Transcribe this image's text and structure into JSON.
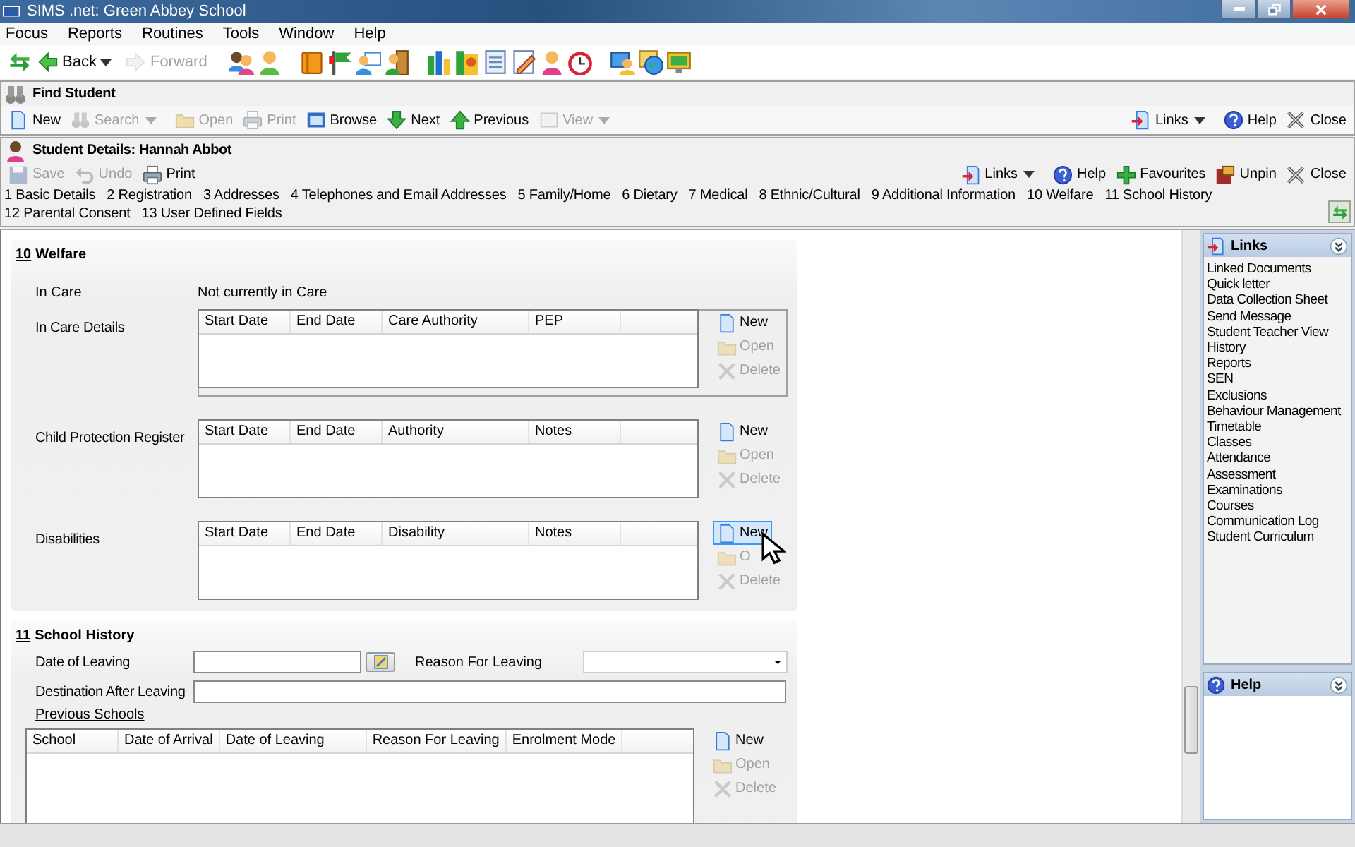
{
  "window": {
    "title": "SIMS .net: Green Abbey School"
  },
  "menu": [
    "Focus",
    "Reports",
    "Routines",
    "Tools",
    "Window",
    "Help"
  ],
  "main_toolbar": [
    {
      "label": "Back",
      "disabled": false,
      "dropdown": true
    },
    {
      "label": "Forward",
      "disabled": true,
      "dropdown": false
    }
  ],
  "find_student": {
    "title": "Find Student",
    "toolbar": [
      {
        "label": "New",
        "disabled": false,
        "dropdown": false
      },
      {
        "label": "Search",
        "disabled": true,
        "dropdown": true
      },
      {
        "label": "Open",
        "disabled": true,
        "dropdown": false
      },
      {
        "label": "Print",
        "disabled": true,
        "dropdown": false
      },
      {
        "label": "Browse",
        "disabled": false,
        "dropdown": false
      },
      {
        "label": "Next",
        "disabled": false,
        "dropdown": false
      },
      {
        "label": "Previous",
        "disabled": false,
        "dropdown": false
      },
      {
        "label": "View",
        "disabled": true,
        "dropdown": true
      }
    ],
    "right_toolbar": [
      {
        "label": "Links",
        "disabled": false,
        "dropdown": true
      },
      {
        "label": "Help",
        "disabled": false,
        "dropdown": false
      },
      {
        "label": "Close",
        "disabled": false,
        "dropdown": false
      }
    ]
  },
  "student_details": {
    "title": "Student Details: Hannah Abbot",
    "toolbar": [
      {
        "label": "Save",
        "disabled": true,
        "dropdown": false
      },
      {
        "label": "Undo",
        "disabled": true,
        "dropdown": false
      },
      {
        "label": "Print",
        "disabled": false,
        "dropdown": false
      }
    ],
    "right_toolbar": [
      {
        "label": "Links",
        "disabled": false,
        "dropdown": true
      },
      {
        "label": "Help",
        "disabled": false,
        "dropdown": false
      },
      {
        "label": "Favourites",
        "disabled": false,
        "dropdown": false
      },
      {
        "label": "Unpin",
        "disabled": false,
        "dropdown": false
      },
      {
        "label": "Close",
        "disabled": false,
        "dropdown": false
      }
    ],
    "tabs": [
      "1 Basic Details",
      "2 Registration",
      "3 Addresses",
      "4 Telephones and Email Addresses",
      "5 Family/Home",
      "6 Dietary",
      "7 Medical",
      "8 Ethnic/Cultural",
      "9 Additional Information",
      "10 Welfare",
      "11 School History",
      "12 Parental Consent",
      "13 User Defined Fields"
    ]
  },
  "welfare": {
    "number": "10",
    "title": "Welfare",
    "in_care": {
      "label": "In Care",
      "value": "Not currently in Care"
    },
    "grids": [
      {
        "label": "In Care Details",
        "framed": true,
        "columns": [
          "Start Date",
          "End Date",
          "Care Authority",
          "PEP"
        ],
        "actions": [
          {
            "label": "New",
            "disabled": false,
            "hovered": false
          },
          {
            "label": "Open",
            "disabled": true,
            "hovered": false
          },
          {
            "label": "Delete",
            "disabled": true,
            "hovered": false
          }
        ]
      },
      {
        "label": "Child Protection Register",
        "framed": false,
        "columns": [
          "Start Date",
          "End Date",
          "Authority",
          "Notes"
        ],
        "actions": [
          {
            "label": "New",
            "disabled": false,
            "hovered": false
          },
          {
            "label": "Open",
            "disabled": true,
            "hovered": false
          },
          {
            "label": "Delete",
            "disabled": true,
            "hovered": false
          }
        ]
      },
      {
        "label": "Disabilities",
        "framed": false,
        "columns": [
          "Start Date",
          "End Date",
          "Disability",
          "Notes"
        ],
        "actions": [
          {
            "label": "New",
            "disabled": false,
            "hovered": true
          },
          {
            "label": "O",
            "disabled": true,
            "hovered": false
          },
          {
            "label": "Delete",
            "disabled": true,
            "hovered": false
          }
        ]
      }
    ]
  },
  "school_history": {
    "number": "11",
    "title": "School History",
    "date_of_leaving": {
      "label": "Date of Leaving"
    },
    "reason_for_leaving": {
      "label": "Reason For Leaving"
    },
    "destination": {
      "label": "Destination After Leaving"
    },
    "previous_schools": {
      "label": "Previous Schools",
      "columns": [
        "School",
        "Date of Arrival",
        "Date of Leaving",
        "Reason For Leaving",
        "Enrolment Mode"
      ],
      "actions": [
        {
          "label": "New",
          "disabled": false,
          "hovered": false
        },
        {
          "label": "Open",
          "disabled": true,
          "hovered": false
        },
        {
          "label": "Delete",
          "disabled": true,
          "hovered": false
        }
      ]
    }
  },
  "links_panel": {
    "title": "Links",
    "items": [
      "Linked Documents",
      "Quick letter",
      "Data Collection Sheet",
      "Send Message",
      "Student Teacher View",
      "History",
      "Reports",
      "SEN",
      "Exclusions",
      "Behaviour Management",
      "Timetable",
      "Classes",
      "Attendance",
      "Assessment",
      "Examinations",
      "Courses",
      "Communication Log",
      "Student Curriculum"
    ]
  },
  "help_panel": {
    "title": "Help"
  }
}
